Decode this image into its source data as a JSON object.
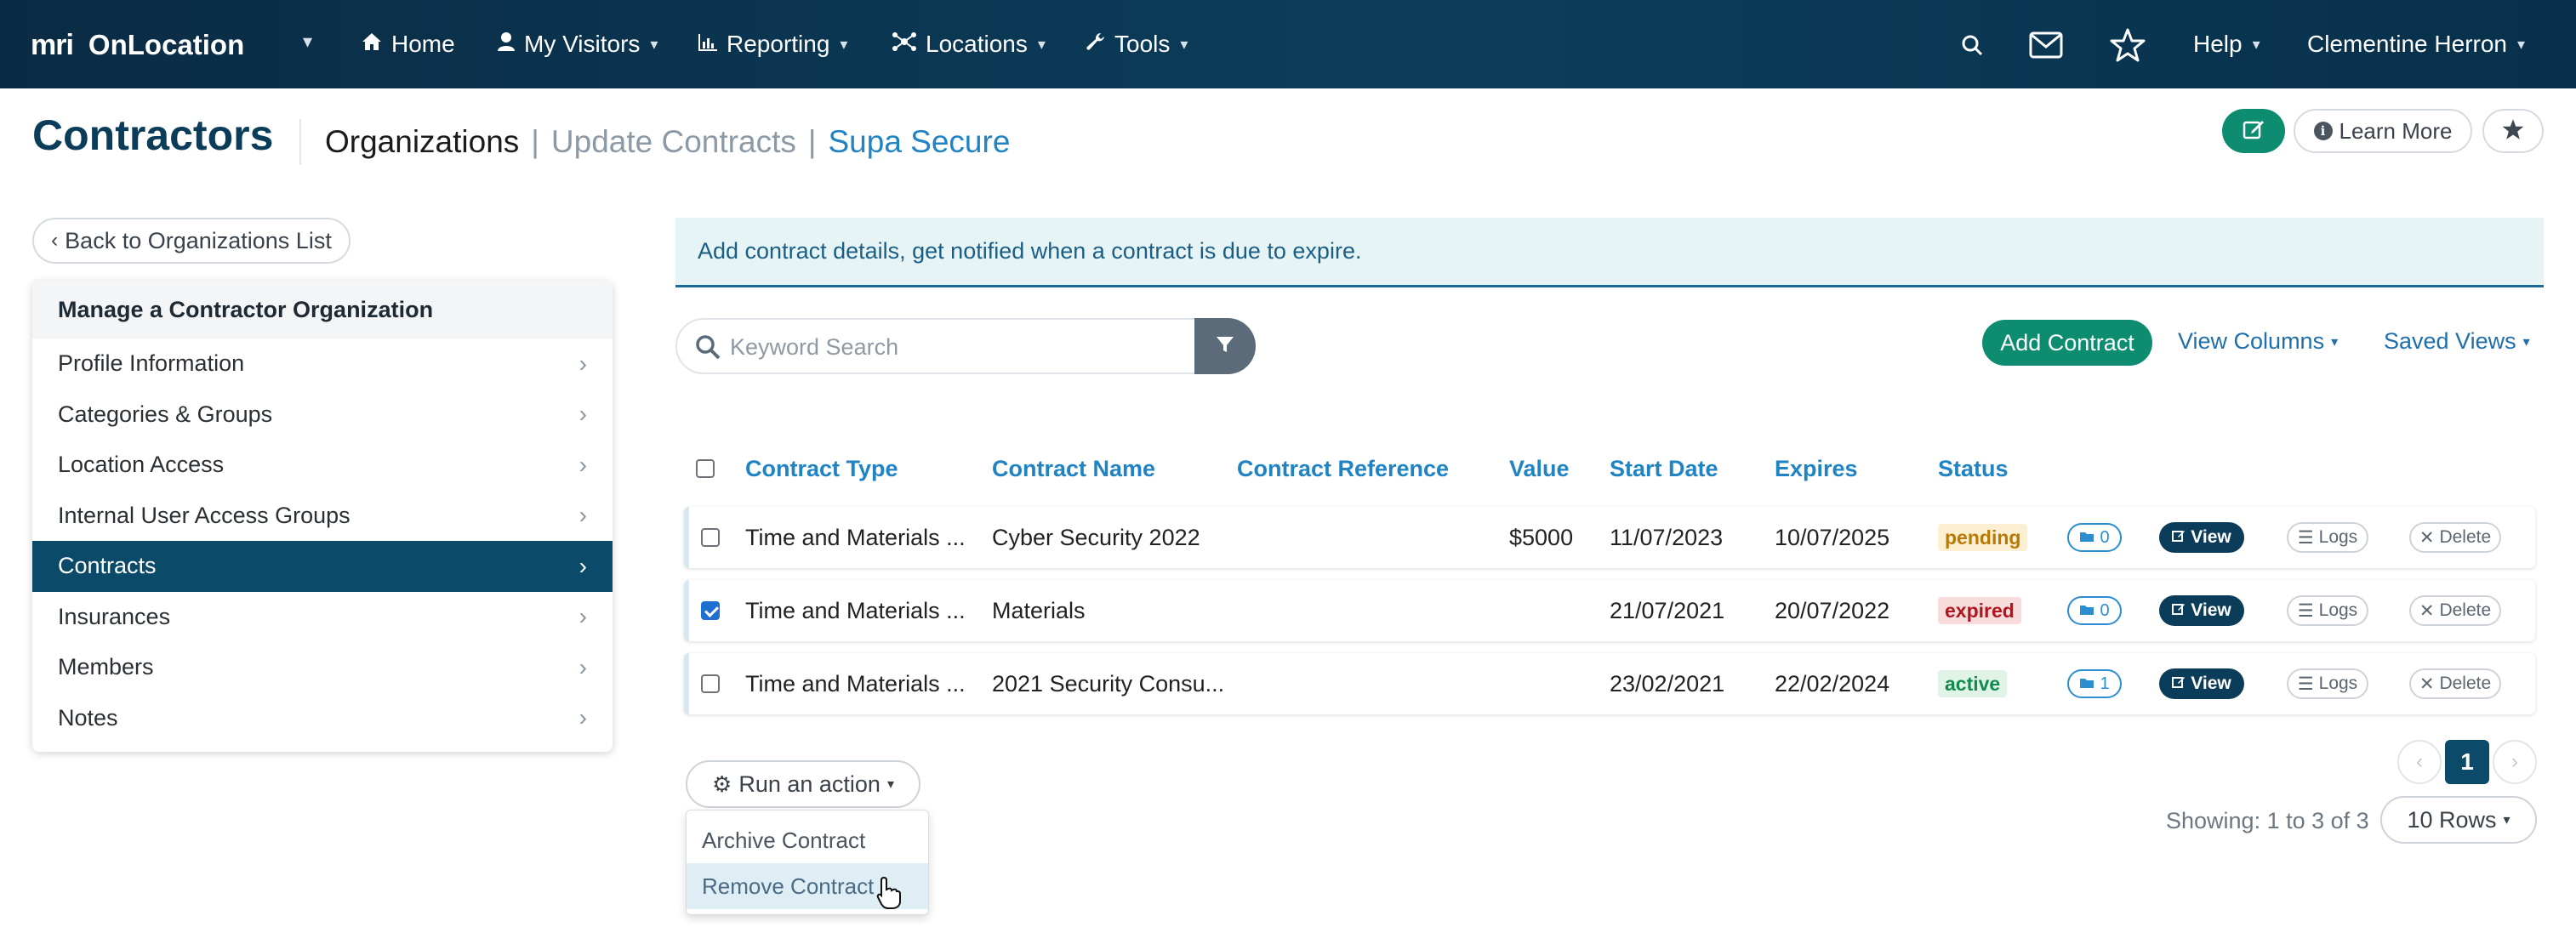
{
  "nav": {
    "brand_mark": "mri",
    "brand_name": "OnLocation",
    "items": [
      {
        "label": "Home",
        "icon": "home-icon"
      },
      {
        "label": "My Visitors",
        "icon": "user-icon"
      },
      {
        "label": "Reporting",
        "icon": "chart-icon"
      },
      {
        "label": "Locations",
        "icon": "network-icon"
      },
      {
        "label": "Tools",
        "icon": "wrench-icon"
      }
    ],
    "help_label": "Help",
    "user_name": "Clementine Herron"
  },
  "header": {
    "title": "Contractors",
    "breadcrumb": {
      "section": "Organizations",
      "separator": "|",
      "page": "Update Contracts",
      "entity": "Supa Secure"
    },
    "learn_more_label": "Learn More"
  },
  "sidebar": {
    "back_label": "Back to Organizations List",
    "heading": "Manage a Contractor Organization",
    "items": [
      {
        "label": "Profile Information",
        "active": false
      },
      {
        "label": "Categories & Groups",
        "active": false
      },
      {
        "label": "Location Access",
        "active": false
      },
      {
        "label": "Internal User Access Groups",
        "active": false
      },
      {
        "label": "Contracts",
        "active": true
      },
      {
        "label": "Insurances",
        "active": false
      },
      {
        "label": "Members",
        "active": false
      },
      {
        "label": "Notes",
        "active": false
      }
    ]
  },
  "main": {
    "alert_text": "Add contract details, get notified when a contract is due to expire.",
    "search_placeholder": "Keyword Search",
    "add_contract_label": "Add Contract",
    "view_columns_label": "View Columns",
    "saved_views_label": "Saved Views"
  },
  "table": {
    "columns": [
      "Contract Type",
      "Contract Name",
      "Contract Reference",
      "Value",
      "Start Date",
      "Expires",
      "Status"
    ],
    "rows": [
      {
        "checked": false,
        "type": "Time and Materials ...",
        "name": "Cyber Security 2022",
        "reference": "",
        "value": "$5000",
        "start": "11/07/2023",
        "expires": "10/07/2025",
        "status": "pending",
        "files": "0"
      },
      {
        "checked": true,
        "type": "Time and Materials ...",
        "name": "Materials",
        "reference": "",
        "value": "",
        "start": "21/07/2021",
        "expires": "20/07/2022",
        "status": "expired",
        "files": "0"
      },
      {
        "checked": false,
        "type": "Time and Materials ...",
        "name": "2021 Security Consu...",
        "reference": "",
        "value": "",
        "start": "23/02/2021",
        "expires": "22/02/2024",
        "status": "active",
        "files": "1"
      }
    ],
    "view_label": "View",
    "logs_label": "Logs",
    "delete_label": "Delete"
  },
  "actions": {
    "run_label": "Run an action",
    "menu": [
      "Archive Contract",
      "Remove Contract"
    ]
  },
  "pagination": {
    "current_page": "1",
    "showing_text": "Showing: 1 to 3 of 3",
    "rows_label": "10 Rows"
  },
  "colors": {
    "nav_bg": "#0b3d5a",
    "accent_green": "#0e8c6f",
    "link_blue": "#1f83c4",
    "active_item": "#0b4a68"
  }
}
